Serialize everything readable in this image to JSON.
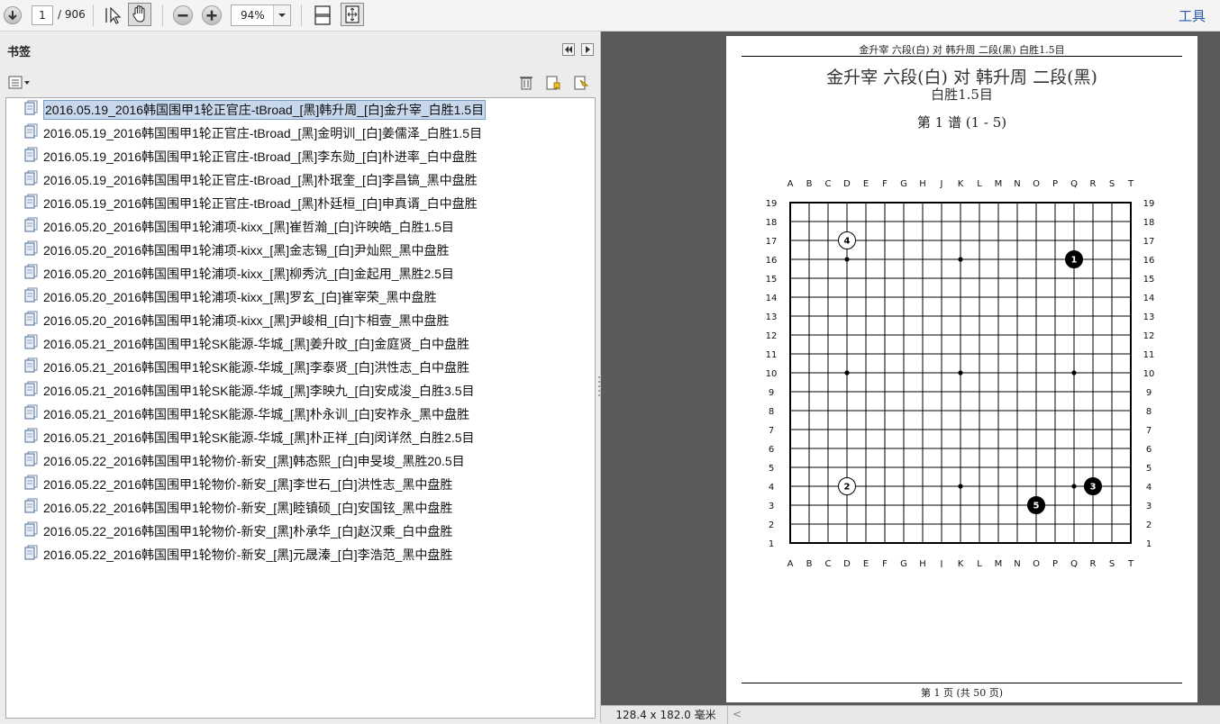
{
  "toolbar": {
    "current_page": "1",
    "total_pages": "/ 906",
    "zoom": "94%",
    "tools_label": "工具"
  },
  "bookmarks_panel": {
    "title": "书签",
    "items": [
      {
        "label": "2016.05.19_2016韩国围甲1轮正官庄-tBroad_[黑]韩升周_[白]金升宰_白胜1.5目",
        "selected": true
      },
      {
        "label": "2016.05.19_2016韩国围甲1轮正官庄-tBroad_[黑]金明训_[白]姜儒泽_白胜1.5目"
      },
      {
        "label": "2016.05.19_2016韩国围甲1轮正官庄-tBroad_[黑]李东勋_[白]朴进率_白中盘胜"
      },
      {
        "label": "2016.05.19_2016韩国围甲1轮正官庄-tBroad_[黑]朴珉奎_[白]李昌镐_黑中盘胜"
      },
      {
        "label": "2016.05.19_2016韩国围甲1轮正官庄-tBroad_[黑]朴廷桓_[白]申真谞_白中盘胜"
      },
      {
        "label": "2016.05.20_2016韩国围甲1轮浦项-kixx_[黑]崔哲瀚_[白]许映皓_白胜1.5目"
      },
      {
        "label": "2016.05.20_2016韩国围甲1轮浦项-kixx_[黑]金志锡_[白]尹灿熙_黑中盘胜"
      },
      {
        "label": "2016.05.20_2016韩国围甲1轮浦项-kixx_[黑]柳秀沆_[白]金起用_黑胜2.5目"
      },
      {
        "label": "2016.05.20_2016韩国围甲1轮浦项-kixx_[黑]罗玄_[白]崔宰荣_黑中盘胜"
      },
      {
        "label": "2016.05.20_2016韩国围甲1轮浦项-kixx_[黑]尹峻相_[白]卞相壹_黑中盘胜"
      },
      {
        "label": "2016.05.21_2016韩国围甲1轮SK能源-华城_[黑]姜升旼_[白]金庭贤_白中盘胜"
      },
      {
        "label": "2016.05.21_2016韩国围甲1轮SK能源-华城_[黑]李泰贤_[白]洪性志_白中盘胜"
      },
      {
        "label": "2016.05.21_2016韩国围甲1轮SK能源-华城_[黑]李映九_[白]安成浚_白胜3.5目"
      },
      {
        "label": "2016.05.21_2016韩国围甲1轮SK能源-华城_[黑]朴永训_[白]安祚永_黑中盘胜"
      },
      {
        "label": "2016.05.21_2016韩国围甲1轮SK能源-华城_[黑]朴正祥_[白]闵详然_白胜2.5目"
      },
      {
        "label": "2016.05.22_2016韩国围甲1轮物价-新安_[黑]韩态熙_[白]申旻埈_黑胜20.5目"
      },
      {
        "label": "2016.05.22_2016韩国围甲1轮物价-新安_[黑]李世石_[白]洪性志_黑中盘胜"
      },
      {
        "label": "2016.05.22_2016韩国围甲1轮物价-新安_[黑]睦镇硕_[白]安国铉_黑中盘胜"
      },
      {
        "label": "2016.05.22_2016韩国围甲1轮物价-新安_[黑]朴承华_[白]赵汉乘_白中盘胜"
      },
      {
        "label": "2016.05.22_2016韩国围甲1轮物价-新安_[黑]元晟溱_[白]李浩范_黑中盘胜"
      }
    ]
  },
  "document": {
    "header": "金升宰 六段(白) 对 韩升周 二段(黑) 白胜1.5目",
    "title": "金升宰 六段(白) 对 韩升周 二段(黑)",
    "subtitle": "白胜1.5目",
    "diagram_title": "第 1 谱 (1 - 5)",
    "footer": "第 1 页 (共 50 页)",
    "columns": [
      "A",
      "B",
      "C",
      "D",
      "E",
      "F",
      "G",
      "H",
      "J",
      "K",
      "L",
      "M",
      "N",
      "O",
      "P",
      "Q",
      "R",
      "S",
      "T"
    ],
    "rows": [
      "19",
      "18",
      "17",
      "16",
      "15",
      "14",
      "13",
      "12",
      "11",
      "10",
      "9",
      "8",
      "7",
      "6",
      "5",
      "4",
      "3",
      "2",
      "1"
    ],
    "stones": [
      {
        "move": "1",
        "color": "black",
        "col": "Q",
        "row": 16
      },
      {
        "move": "2",
        "color": "white",
        "col": "D",
        "row": 4
      },
      {
        "move": "3",
        "color": "black",
        "col": "R",
        "row": 4
      },
      {
        "move": "4",
        "color": "white",
        "col": "D",
        "row": 17
      },
      {
        "move": "5",
        "color": "black",
        "col": "O",
        "row": 3
      }
    ]
  },
  "status": {
    "dimensions": "128.4 x 182.0 毫米",
    "nav": "<"
  }
}
